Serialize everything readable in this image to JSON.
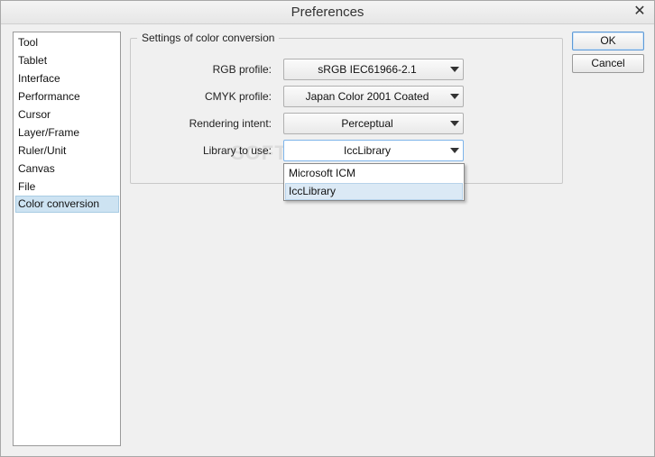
{
  "window": {
    "title": "Preferences",
    "close_glyph": "✕"
  },
  "sidebar": {
    "items": [
      {
        "label": "Tool"
      },
      {
        "label": "Tablet"
      },
      {
        "label": "Interface"
      },
      {
        "label": "Performance"
      },
      {
        "label": "Cursor"
      },
      {
        "label": "Layer/Frame"
      },
      {
        "label": "Ruler/Unit"
      },
      {
        "label": "Canvas"
      },
      {
        "label": "File"
      },
      {
        "label": "Color conversion"
      }
    ],
    "selected": "Color conversion"
  },
  "settings": {
    "group_title": "Settings of color conversion",
    "rgb_profile": {
      "label": "RGB profile:",
      "value": "sRGB IEC61966-2.1"
    },
    "cmyk_profile": {
      "label": "CMYK profile:",
      "value": "Japan Color 2001 Coated"
    },
    "rendering_intent": {
      "label": "Rendering intent:",
      "value": "Perceptual"
    },
    "library": {
      "label": "Library to use:",
      "value": "IccLibrary",
      "options": [
        "Microsoft ICM",
        "IccLibrary"
      ]
    }
  },
  "watermark": "SOFTPEDIA",
  "buttons": {
    "ok": "OK",
    "cancel": "Cancel"
  }
}
